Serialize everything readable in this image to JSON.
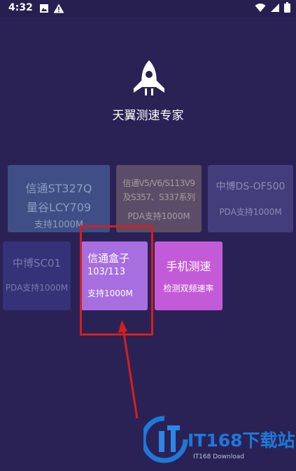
{
  "status_bar": {
    "time": "4:32",
    "left_icons": [
      "image-notification-icon",
      "warning-icon"
    ],
    "right_icons": [
      "wifi-icon",
      "signal-icon",
      "battery-icon"
    ]
  },
  "app": {
    "logo_icon": "rocket-icon",
    "title": "天翼测速专家"
  },
  "cards": [
    {
      "lines": [
        "信通ST327Q",
        "量谷LCY709",
        "支持1000M"
      ]
    },
    {
      "lines": [
        "信通V5/V6/S113V9",
        "及S357、S337系列",
        "PDA支持1000M"
      ]
    },
    {
      "lines": [
        "中博DS-OF500",
        "PDA支持1000M"
      ]
    },
    {
      "lines": [
        "中博SC01",
        "PDA支持1000M"
      ]
    },
    {
      "lines": [
        "信通盒子",
        "103/113",
        "支持1000M"
      ]
    },
    {
      "lines": [
        "手机测速",
        "检测双频速率"
      ]
    }
  ],
  "annotation": {
    "highlight_color": "#d51f1f"
  },
  "watermark": {
    "brand": "IT168下载站",
    "sub": "IT168 Download"
  },
  "colors": {
    "background": "#2a2255",
    "card_selected": "#a76ee0",
    "card_speedtest": "#c35bd8"
  }
}
